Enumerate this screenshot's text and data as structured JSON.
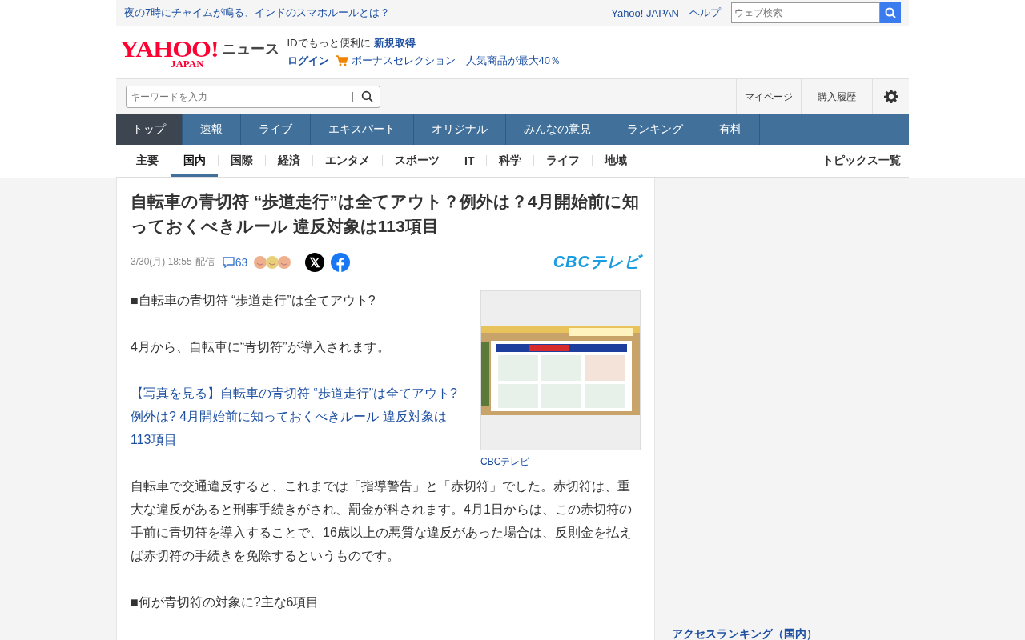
{
  "top_bar": {
    "headline_link": "夜の7時にチャイムが鳴る、インドのスマホルールとは？",
    "links": [
      "Yahoo! JAPAN",
      "ヘルプ"
    ],
    "search": {
      "placeholder": "ウェブ検索"
    }
  },
  "header": {
    "logo": {
      "main": "YAHOO!",
      "sub": "JAPAN",
      "service": "ニュース"
    },
    "promo_text": "IDでもっと便利に",
    "signup_link": "新規取得",
    "login_link": "ログイン",
    "bonus_link": "ボーナスセレクション　人気商品が最大40％"
  },
  "search": {
    "placeholder": "キーワードを入力"
  },
  "user_links": [
    "マイページ",
    "購入履歴"
  ],
  "nav_tabs": [
    {
      "label": "トップ",
      "selected": true
    },
    {
      "label": "速報",
      "selected": false
    },
    {
      "label": "ライブ",
      "selected": false
    },
    {
      "label": "エキスパート",
      "selected": false
    },
    {
      "label": "オリジナル",
      "selected": false
    },
    {
      "label": "みんなの意見",
      "selected": false
    },
    {
      "label": "ランキング",
      "selected": false
    },
    {
      "label": "有料",
      "selected": false
    }
  ],
  "categories": [
    {
      "label": "主要",
      "selected": false
    },
    {
      "label": "国内",
      "selected": true
    },
    {
      "label": "国際",
      "selected": false
    },
    {
      "label": "経済",
      "selected": false
    },
    {
      "label": "エンタメ",
      "selected": false
    },
    {
      "label": "スポーツ",
      "selected": false
    },
    {
      "label": "IT",
      "selected": false
    },
    {
      "label": "科学",
      "selected": false
    },
    {
      "label": "ライフ",
      "selected": false
    },
    {
      "label": "地域",
      "selected": false
    }
  ],
  "topics_link": "トピックス一覧",
  "article": {
    "title": "自転車の青切符 “歩道走行”は全てアウト？例外は？4月開始前に知っておくべきルール 違反対象は113項目",
    "date": "3/30(月) 18:55",
    "delivered": "配信",
    "comment_count": "63",
    "source_logo": "CBCテレビ",
    "photo": {
      "kind": "picture",
      "caption": "CBCテレビ"
    },
    "paragraphs": [
      {
        "kind": "text",
        "text": "■自転車の青切符 “歩道走行”は全てアウト?"
      },
      {
        "kind": "text",
        "text": "4月から、自転車に“青切符”が導入されます。"
      },
      {
        "kind": "link",
        "text": "【写真を見る】自転車の青切符 “歩道走行”は全てアウト?例外は? 4月開始前に知っておくべきルール 違反対象は113項目"
      },
      {
        "kind": "text",
        "text": "自転車で交通違反すると、これまでは「指導警告」と「赤切符」でした。赤切符は、重大な違反があると刑事手続きがされ、罰金が科されます。4月1日からは、この赤切符の手前に青切符を導入することで、16歳以上の悪質な違反があった場合は、反則金を払えば赤切符の手続きを免除するというものです。"
      },
      {
        "kind": "text",
        "text": "■何が青切符の対象に?主な6項目"
      }
    ]
  },
  "sidebar": {
    "ranking_title": "アクセスランキング（国内）"
  }
}
